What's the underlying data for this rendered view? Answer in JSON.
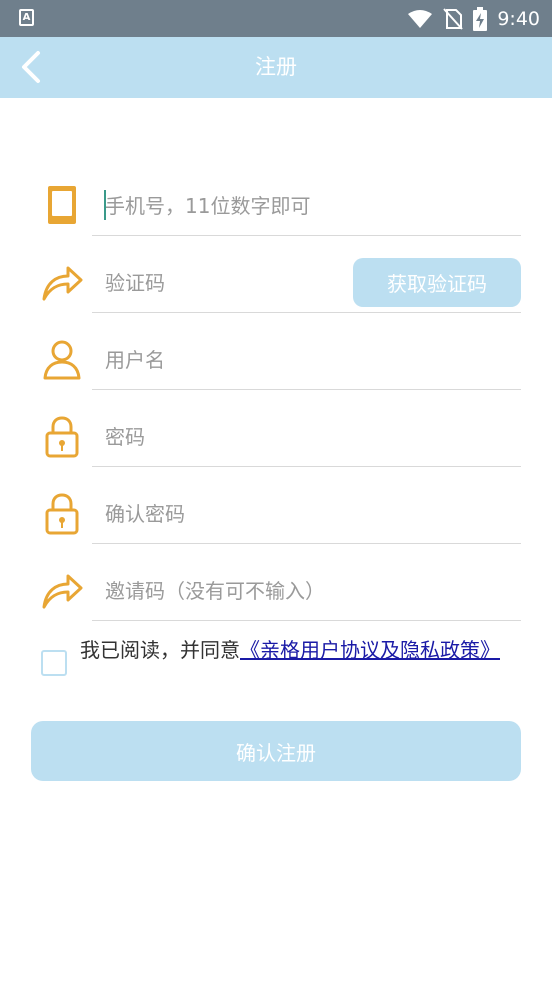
{
  "status_bar": {
    "app_icon_letter": "A",
    "time": "9:40",
    "icons": [
      "wifi-icon",
      "no-sim-icon",
      "battery-charging-icon"
    ]
  },
  "app_bar": {
    "title": "注册",
    "back_icon": "chevron-left-icon"
  },
  "form": {
    "phone": {
      "placeholder": "手机号，11位数字即可",
      "icon": "phone-icon"
    },
    "code": {
      "placeholder": "验证码",
      "icon": "share-arrow-icon",
      "button_label": "获取验证码"
    },
    "username": {
      "placeholder": "用户名",
      "icon": "user-icon"
    },
    "password": {
      "placeholder": "密码",
      "icon": "lock-icon"
    },
    "confirm_password": {
      "placeholder": "确认密码",
      "icon": "lock-icon"
    },
    "invite": {
      "placeholder": "邀请码（没有可不输入）",
      "icon": "share-arrow-icon"
    }
  },
  "agreement": {
    "prefix": "我已阅读，并同意",
    "link": "《亲格用户协议及隐私政策》",
    "checked": false
  },
  "submit": {
    "label": "确认注册"
  },
  "colors": {
    "status_bar": "#6f7f8c",
    "app_bar": "#bcdff1",
    "icon_accent": "#e8a634",
    "link": "#1a1aa6",
    "cursor": "#3a9a8a"
  }
}
